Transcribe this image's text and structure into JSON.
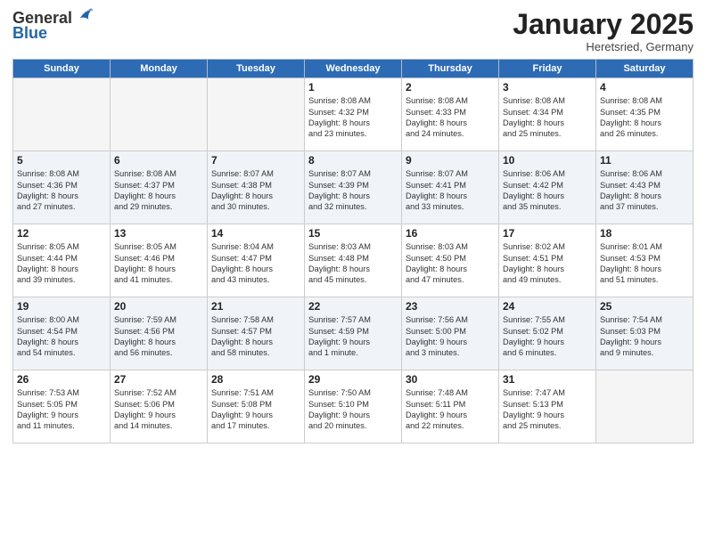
{
  "header": {
    "logo_general": "General",
    "logo_blue": "Blue",
    "month": "January 2025",
    "location": "Heretsried, Germany"
  },
  "weekdays": [
    "Sunday",
    "Monday",
    "Tuesday",
    "Wednesday",
    "Thursday",
    "Friday",
    "Saturday"
  ],
  "weeks": [
    [
      {
        "day": "",
        "info": ""
      },
      {
        "day": "",
        "info": ""
      },
      {
        "day": "",
        "info": ""
      },
      {
        "day": "1",
        "info": "Sunrise: 8:08 AM\nSunset: 4:32 PM\nDaylight: 8 hours\nand 23 minutes."
      },
      {
        "day": "2",
        "info": "Sunrise: 8:08 AM\nSunset: 4:33 PM\nDaylight: 8 hours\nand 24 minutes."
      },
      {
        "day": "3",
        "info": "Sunrise: 8:08 AM\nSunset: 4:34 PM\nDaylight: 8 hours\nand 25 minutes."
      },
      {
        "day": "4",
        "info": "Sunrise: 8:08 AM\nSunset: 4:35 PM\nDaylight: 8 hours\nand 26 minutes."
      }
    ],
    [
      {
        "day": "5",
        "info": "Sunrise: 8:08 AM\nSunset: 4:36 PM\nDaylight: 8 hours\nand 27 minutes."
      },
      {
        "day": "6",
        "info": "Sunrise: 8:08 AM\nSunset: 4:37 PM\nDaylight: 8 hours\nand 29 minutes."
      },
      {
        "day": "7",
        "info": "Sunrise: 8:07 AM\nSunset: 4:38 PM\nDaylight: 8 hours\nand 30 minutes."
      },
      {
        "day": "8",
        "info": "Sunrise: 8:07 AM\nSunset: 4:39 PM\nDaylight: 8 hours\nand 32 minutes."
      },
      {
        "day": "9",
        "info": "Sunrise: 8:07 AM\nSunset: 4:41 PM\nDaylight: 8 hours\nand 33 minutes."
      },
      {
        "day": "10",
        "info": "Sunrise: 8:06 AM\nSunset: 4:42 PM\nDaylight: 8 hours\nand 35 minutes."
      },
      {
        "day": "11",
        "info": "Sunrise: 8:06 AM\nSunset: 4:43 PM\nDaylight: 8 hours\nand 37 minutes."
      }
    ],
    [
      {
        "day": "12",
        "info": "Sunrise: 8:05 AM\nSunset: 4:44 PM\nDaylight: 8 hours\nand 39 minutes."
      },
      {
        "day": "13",
        "info": "Sunrise: 8:05 AM\nSunset: 4:46 PM\nDaylight: 8 hours\nand 41 minutes."
      },
      {
        "day": "14",
        "info": "Sunrise: 8:04 AM\nSunset: 4:47 PM\nDaylight: 8 hours\nand 43 minutes."
      },
      {
        "day": "15",
        "info": "Sunrise: 8:03 AM\nSunset: 4:48 PM\nDaylight: 8 hours\nand 45 minutes."
      },
      {
        "day": "16",
        "info": "Sunrise: 8:03 AM\nSunset: 4:50 PM\nDaylight: 8 hours\nand 47 minutes."
      },
      {
        "day": "17",
        "info": "Sunrise: 8:02 AM\nSunset: 4:51 PM\nDaylight: 8 hours\nand 49 minutes."
      },
      {
        "day": "18",
        "info": "Sunrise: 8:01 AM\nSunset: 4:53 PM\nDaylight: 8 hours\nand 51 minutes."
      }
    ],
    [
      {
        "day": "19",
        "info": "Sunrise: 8:00 AM\nSunset: 4:54 PM\nDaylight: 8 hours\nand 54 minutes."
      },
      {
        "day": "20",
        "info": "Sunrise: 7:59 AM\nSunset: 4:56 PM\nDaylight: 8 hours\nand 56 minutes."
      },
      {
        "day": "21",
        "info": "Sunrise: 7:58 AM\nSunset: 4:57 PM\nDaylight: 8 hours\nand 58 minutes."
      },
      {
        "day": "22",
        "info": "Sunrise: 7:57 AM\nSunset: 4:59 PM\nDaylight: 9 hours\nand 1 minute."
      },
      {
        "day": "23",
        "info": "Sunrise: 7:56 AM\nSunset: 5:00 PM\nDaylight: 9 hours\nand 3 minutes."
      },
      {
        "day": "24",
        "info": "Sunrise: 7:55 AM\nSunset: 5:02 PM\nDaylight: 9 hours\nand 6 minutes."
      },
      {
        "day": "25",
        "info": "Sunrise: 7:54 AM\nSunset: 5:03 PM\nDaylight: 9 hours\nand 9 minutes."
      }
    ],
    [
      {
        "day": "26",
        "info": "Sunrise: 7:53 AM\nSunset: 5:05 PM\nDaylight: 9 hours\nand 11 minutes."
      },
      {
        "day": "27",
        "info": "Sunrise: 7:52 AM\nSunset: 5:06 PM\nDaylight: 9 hours\nand 14 minutes."
      },
      {
        "day": "28",
        "info": "Sunrise: 7:51 AM\nSunset: 5:08 PM\nDaylight: 9 hours\nand 17 minutes."
      },
      {
        "day": "29",
        "info": "Sunrise: 7:50 AM\nSunset: 5:10 PM\nDaylight: 9 hours\nand 20 minutes."
      },
      {
        "day": "30",
        "info": "Sunrise: 7:48 AM\nSunset: 5:11 PM\nDaylight: 9 hours\nand 22 minutes."
      },
      {
        "day": "31",
        "info": "Sunrise: 7:47 AM\nSunset: 5:13 PM\nDaylight: 9 hours\nand 25 minutes."
      },
      {
        "day": "",
        "info": ""
      }
    ]
  ]
}
